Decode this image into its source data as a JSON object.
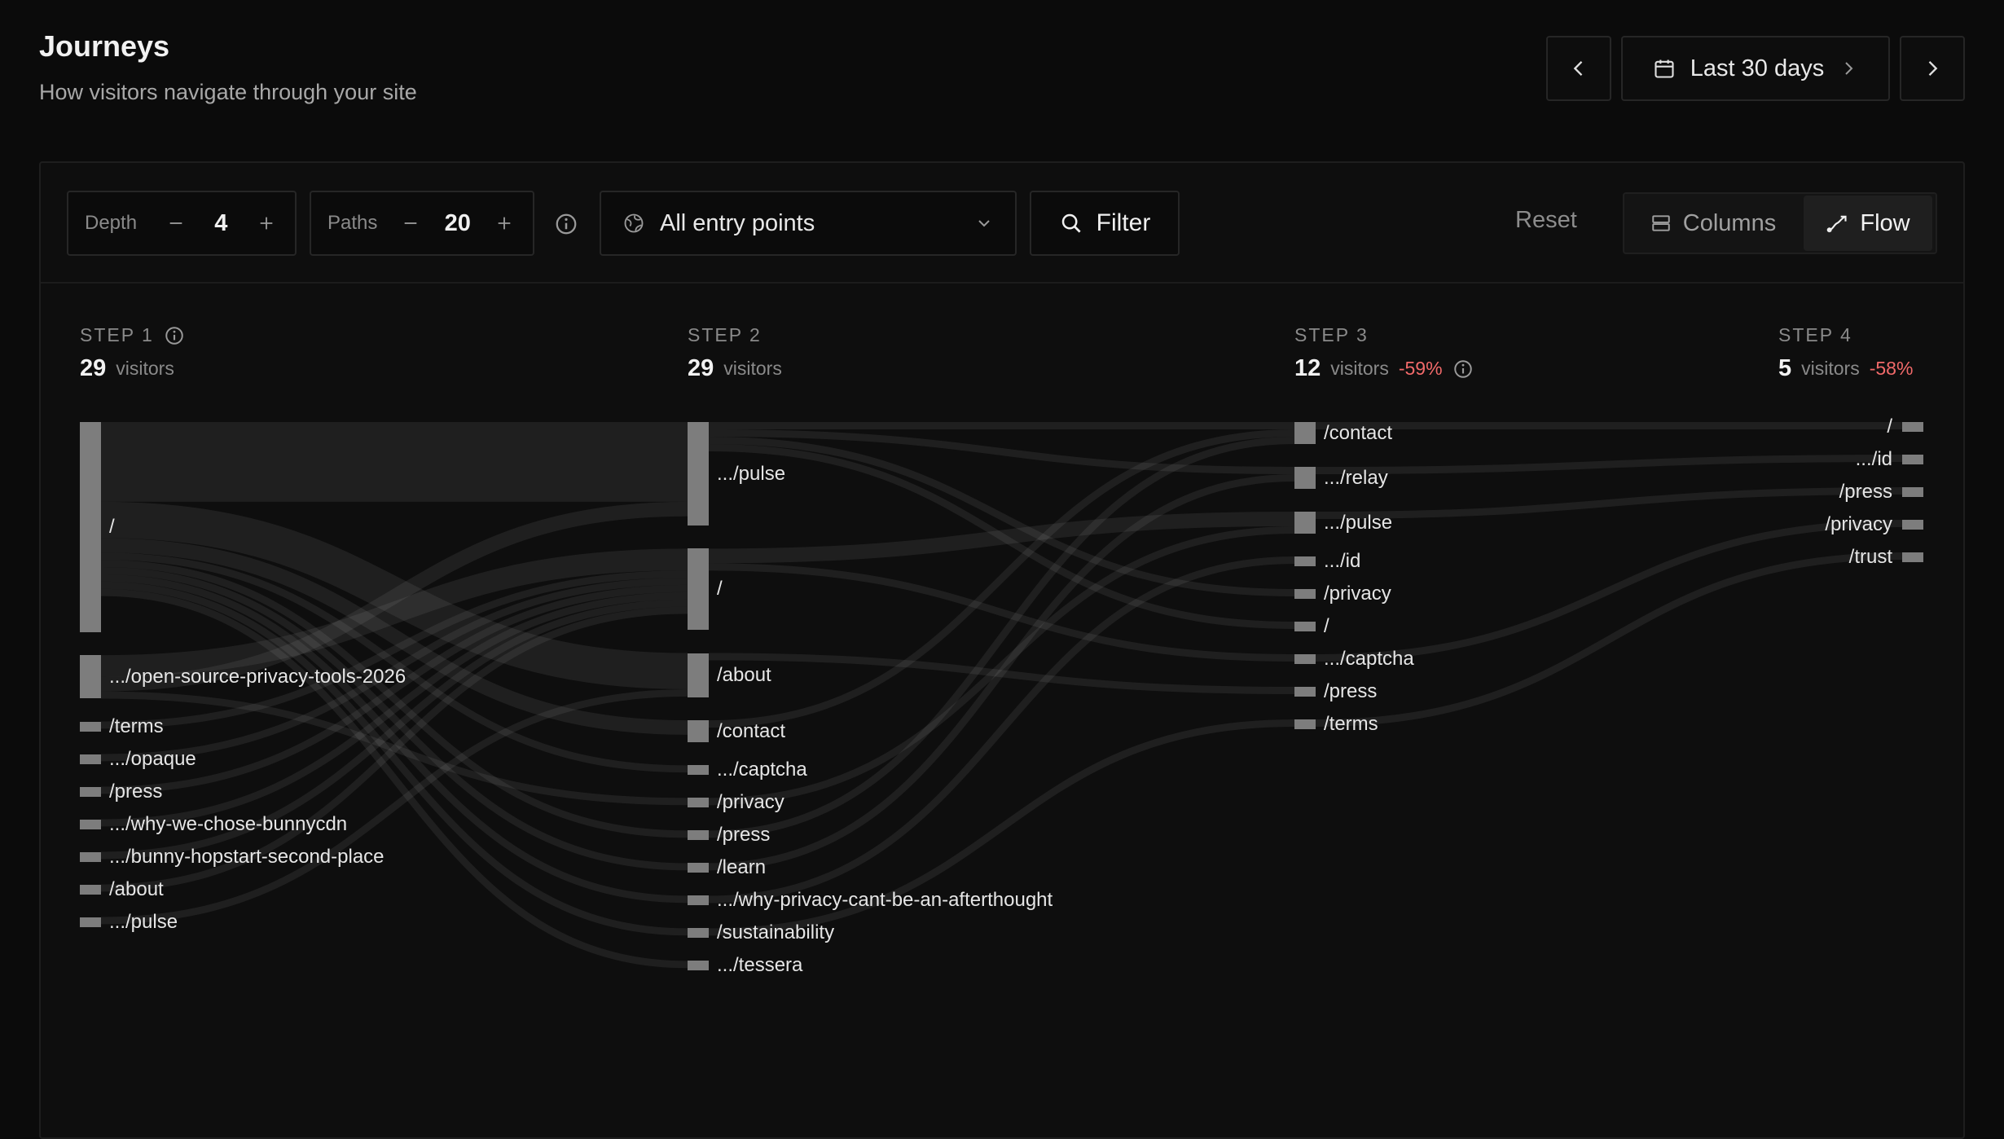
{
  "header": {
    "title": "Journeys",
    "subtitle": "How visitors navigate through your site"
  },
  "date_range": {
    "label": "Last 30 days"
  },
  "toolbar": {
    "depth_label": "Depth",
    "depth_value": "4",
    "paths_label": "Paths",
    "paths_value": "20",
    "entry_select": "All entry points",
    "filter_label": "Filter",
    "reset_label": "Reset",
    "columns_label": "Columns",
    "flow_label": "Flow",
    "active_view": "Flow"
  },
  "steps": [
    {
      "title": "STEP 1",
      "visitors": "29",
      "visitors_label": "visitors",
      "change": "",
      "nodes": [
        {
          "label": "/",
          "value": 29
        },
        {
          "label": ".../open-source-privacy-tools-2026",
          "value": 6
        },
        {
          "label": "/terms",
          "value": 1
        },
        {
          "label": ".../opaque",
          "value": 1
        },
        {
          "label": "/press",
          "value": 1
        },
        {
          "label": ".../why-we-chose-bunnycdn",
          "value": 1
        },
        {
          "label": ".../bunny-hopstart-second-place",
          "value": 1
        },
        {
          "label": "/about",
          "value": 1
        },
        {
          "label": ".../pulse",
          "value": 1
        }
      ]
    },
    {
      "title": "STEP 2",
      "visitors": "29",
      "visitors_label": "visitors",
      "change": "",
      "nodes": [
        {
          "label": ".../pulse",
          "value": 14
        },
        {
          "label": "/",
          "value": 11
        },
        {
          "label": "/about",
          "value": 6
        },
        {
          "label": "/contact",
          "value": 3
        },
        {
          "label": ".../captcha",
          "value": 1
        },
        {
          "label": "/privacy",
          "value": 1
        },
        {
          "label": "/press",
          "value": 1
        },
        {
          "label": "/learn",
          "value": 1
        },
        {
          "label": ".../why-privacy-cant-be-an-afterthought",
          "value": 1
        },
        {
          "label": "/sustainability",
          "value": 1
        },
        {
          "label": ".../tessera",
          "value": 1
        }
      ]
    },
    {
      "title": "STEP 3",
      "visitors": "12",
      "visitors_label": "visitors",
      "change": "-59%",
      "nodes": [
        {
          "label": "/contact",
          "value": 3
        },
        {
          "label": ".../relay",
          "value": 3
        },
        {
          "label": ".../pulse",
          "value": 3
        },
        {
          "label": ".../id",
          "value": 1
        },
        {
          "label": "/privacy",
          "value": 1
        },
        {
          "label": "/",
          "value": 1
        },
        {
          "label": ".../captcha",
          "value": 1
        },
        {
          "label": "/press",
          "value": 1
        },
        {
          "label": "/terms",
          "value": 1
        }
      ]
    },
    {
      "title": "STEP 4",
      "visitors": "5",
      "visitors_label": "visitors",
      "change": "-58%",
      "nodes": [
        {
          "label": "/",
          "value": 1
        },
        {
          "label": ".../id",
          "value": 1
        },
        {
          "label": "/press",
          "value": 1
        },
        {
          "label": "/privacy",
          "value": 1
        },
        {
          "label": "/trust",
          "value": 1
        }
      ]
    }
  ],
  "links": [
    {
      "step": 0,
      "from": 0,
      "to": 0,
      "value": 11
    },
    {
      "step": 0,
      "from": 0,
      "to": 2,
      "value": 5
    },
    {
      "step": 0,
      "from": 0,
      "to": 3,
      "value": 2
    },
    {
      "step": 0,
      "from": 0,
      "to": 4,
      "value": 1
    },
    {
      "step": 0,
      "from": 0,
      "to": 6,
      "value": 1
    },
    {
      "step": 0,
      "from": 0,
      "to": 7,
      "value": 1
    },
    {
      "step": 0,
      "from": 0,
      "to": 8,
      "value": 1
    },
    {
      "step": 0,
      "from": 0,
      "to": 9,
      "value": 1
    },
    {
      "step": 0,
      "from": 0,
      "to": 10,
      "value": 1
    },
    {
      "step": 0,
      "from": 1,
      "to": 1,
      "value": 3
    },
    {
      "step": 0,
      "from": 1,
      "to": 0,
      "value": 2
    },
    {
      "step": 0,
      "from": 1,
      "to": 5,
      "value": 1
    },
    {
      "step": 0,
      "from": 2,
      "to": 1,
      "value": 1
    },
    {
      "step": 0,
      "from": 3,
      "to": 1,
      "value": 1
    },
    {
      "step": 0,
      "from": 4,
      "to": 1,
      "value": 1
    },
    {
      "step": 0,
      "from": 5,
      "to": 1,
      "value": 1
    },
    {
      "step": 0,
      "from": 6,
      "to": 1,
      "value": 1
    },
    {
      "step": 0,
      "from": 7,
      "to": 1,
      "value": 1
    },
    {
      "step": 0,
      "from": 8,
      "to": 2,
      "value": 1
    },
    {
      "step": 1,
      "from": 0,
      "to": 0,
      "value": 1
    },
    {
      "step": 1,
      "from": 0,
      "to": 1,
      "value": 1
    },
    {
      "step": 1,
      "from": 0,
      "to": 4,
      "value": 1
    },
    {
      "step": 1,
      "from": 0,
      "to": 5,
      "value": 1
    },
    {
      "step": 1,
      "from": 1,
      "to": 2,
      "value": 2
    },
    {
      "step": 1,
      "from": 1,
      "to": 6,
      "value": 1
    },
    {
      "step": 1,
      "from": 2,
      "to": 7,
      "value": 1
    },
    {
      "step": 1,
      "from": 3,
      "to": 0,
      "value": 1
    },
    {
      "step": 1,
      "from": 5,
      "to": 2,
      "value": 1
    },
    {
      "step": 1,
      "from": 6,
      "to": 0,
      "value": 1
    },
    {
      "step": 1,
      "from": 7,
      "to": 1,
      "value": 1
    },
    {
      "step": 1,
      "from": 8,
      "to": 3,
      "value": 1
    },
    {
      "step": 1,
      "from": 9,
      "to": 8,
      "value": 1
    },
    {
      "step": 2,
      "from": 0,
      "to": 0,
      "value": 1
    },
    {
      "step": 2,
      "from": 1,
      "to": 1,
      "value": 1
    },
    {
      "step": 2,
      "from": 2,
      "to": 2,
      "value": 1
    },
    {
      "step": 2,
      "from": 6,
      "to": 3,
      "value": 1
    },
    {
      "step": 2,
      "from": 8,
      "to": 4,
      "value": 1
    }
  ]
}
